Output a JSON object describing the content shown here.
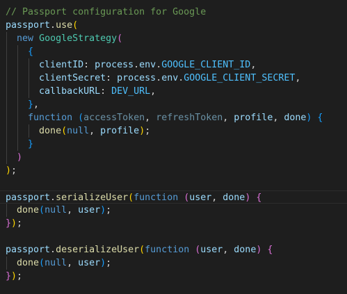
{
  "editor": {
    "current_line": 15,
    "colors": {
      "background": "#1e1e1e",
      "comment": "#6a9955",
      "variable": "#9cdcfe",
      "function": "#dcdcaa",
      "keyword": "#569cd6",
      "class": "#4ec9b0",
      "bracket1": "#ffd700",
      "bracket2": "#da70d6",
      "bracket3": "#179fff",
      "constant": "#4fc1ff"
    },
    "lines": [
      [
        [
          "// Passport configuration for Google",
          "c"
        ]
      ],
      [
        [
          "passport",
          "v"
        ],
        [
          ".",
          "pu"
        ],
        [
          "use",
          "f"
        ],
        [
          "(",
          "g"
        ]
      ],
      [
        [
          "  ",
          "pu"
        ],
        [
          "new",
          "k"
        ],
        [
          " ",
          "pu"
        ],
        [
          "GoogleStrategy",
          "cl"
        ],
        [
          "(",
          "p"
        ]
      ],
      [
        [
          "    ",
          "pu"
        ],
        [
          "{",
          "b"
        ]
      ],
      [
        [
          "      ",
          "pu"
        ],
        [
          "clientID",
          "v"
        ],
        [
          ": ",
          "pu"
        ],
        [
          "process",
          "v"
        ],
        [
          ".",
          "pu"
        ],
        [
          "env",
          "v"
        ],
        [
          ".",
          "pu"
        ],
        [
          "GOOGLE_CLIENT_ID",
          "con"
        ],
        [
          ",",
          "pu"
        ]
      ],
      [
        [
          "      ",
          "pu"
        ],
        [
          "clientSecret",
          "v"
        ],
        [
          ": ",
          "pu"
        ],
        [
          "process",
          "v"
        ],
        [
          ".",
          "pu"
        ],
        [
          "env",
          "v"
        ],
        [
          ".",
          "pu"
        ],
        [
          "GOOGLE_CLIENT_SECRET",
          "con"
        ],
        [
          ",",
          "pu"
        ]
      ],
      [
        [
          "      ",
          "pu"
        ],
        [
          "callbackURL",
          "v"
        ],
        [
          ": ",
          "pu"
        ],
        [
          "DEV_URL",
          "con"
        ],
        [
          ",",
          "pu"
        ]
      ],
      [
        [
          "    ",
          "pu"
        ],
        [
          "}",
          "b"
        ],
        [
          ",",
          "pu"
        ]
      ],
      [
        [
          "    ",
          "pu"
        ],
        [
          "function",
          "k"
        ],
        [
          " ",
          "pu"
        ],
        [
          "(",
          "b"
        ],
        [
          "accessToken",
          "dim"
        ],
        [
          ", ",
          "pu"
        ],
        [
          "refreshToken",
          "dim"
        ],
        [
          ", ",
          "pu"
        ],
        [
          "profile",
          "v"
        ],
        [
          ", ",
          "pu"
        ],
        [
          "done",
          "v"
        ],
        [
          ")",
          "b"
        ],
        [
          " ",
          "pu"
        ],
        [
          "{",
          "b"
        ]
      ],
      [
        [
          "      ",
          "pu"
        ],
        [
          "done",
          "f"
        ],
        [
          "(",
          "g"
        ],
        [
          "null",
          "k"
        ],
        [
          ", ",
          "pu"
        ],
        [
          "profile",
          "v"
        ],
        [
          ")",
          "g"
        ],
        [
          ";",
          "pu"
        ]
      ],
      [
        [
          "    ",
          "pu"
        ],
        [
          "}",
          "b"
        ]
      ],
      [
        [
          "  ",
          "pu"
        ],
        [
          ")",
          "p"
        ]
      ],
      [
        [
          ")",
          "g"
        ],
        [
          ";",
          "pu"
        ]
      ],
      [],
      [
        [
          "passport",
          "v"
        ],
        [
          ".",
          "pu"
        ],
        [
          "serializeUser",
          "f"
        ],
        [
          "(",
          "g"
        ],
        [
          "function",
          "k"
        ],
        [
          " ",
          "pu"
        ],
        [
          "(",
          "p"
        ],
        [
          "user",
          "v"
        ],
        [
          ", ",
          "pu"
        ],
        [
          "done",
          "v"
        ],
        [
          ")",
          "p"
        ],
        [
          " ",
          "pu"
        ],
        [
          "{",
          "p"
        ]
      ],
      [
        [
          "  ",
          "pu"
        ],
        [
          "done",
          "f"
        ],
        [
          "(",
          "b"
        ],
        [
          "null",
          "k"
        ],
        [
          ", ",
          "pu"
        ],
        [
          "user",
          "v"
        ],
        [
          ")",
          "b"
        ],
        [
          ";",
          "pu"
        ]
      ],
      [
        [
          "}",
          "p"
        ],
        [
          ")",
          "g"
        ],
        [
          ";",
          "pu"
        ]
      ],
      [],
      [
        [
          "passport",
          "v"
        ],
        [
          ".",
          "pu"
        ],
        [
          "deserializeUser",
          "f"
        ],
        [
          "(",
          "g"
        ],
        [
          "function",
          "k"
        ],
        [
          " ",
          "pu"
        ],
        [
          "(",
          "p"
        ],
        [
          "user",
          "v"
        ],
        [
          ", ",
          "pu"
        ],
        [
          "done",
          "v"
        ],
        [
          ")",
          "p"
        ],
        [
          " ",
          "pu"
        ],
        [
          "{",
          "p"
        ]
      ],
      [
        [
          "  ",
          "pu"
        ],
        [
          "done",
          "f"
        ],
        [
          "(",
          "b"
        ],
        [
          "null",
          "k"
        ],
        [
          ", ",
          "pu"
        ],
        [
          "user",
          "v"
        ],
        [
          ")",
          "b"
        ],
        [
          ";",
          "pu"
        ]
      ],
      [
        [
          "}",
          "p"
        ],
        [
          ")",
          "g"
        ],
        [
          ";",
          "pu"
        ]
      ]
    ]
  }
}
